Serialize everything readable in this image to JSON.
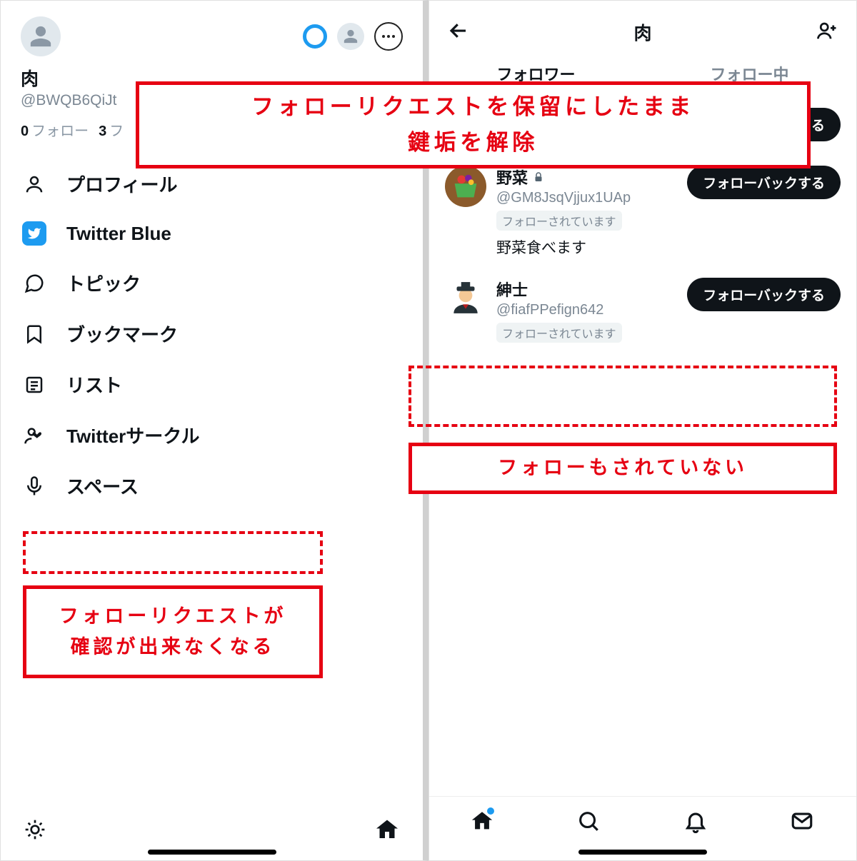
{
  "left": {
    "name": "肉",
    "handle": "@BWQB6QiJt",
    "following_count": "0",
    "following_label": "フォロー",
    "followers_count": "3",
    "followers_label": "フ",
    "menu": {
      "profile": "プロフィール",
      "blue": "Twitter Blue",
      "topics": "トピック",
      "bookmarks": "ブックマーク",
      "lists": "リスト",
      "circle": "Twitterサークル",
      "spaces": "スペース"
    }
  },
  "right": {
    "title": "肉",
    "tabs": {
      "followers": "フォロワー",
      "following": "フォロー中"
    },
    "follow_btn": "フォローする",
    "followback_btn": "フォローバックする",
    "followed_badge": "フォローされています",
    "users": [
      {
        "name": "野菜",
        "locked": true,
        "handle": "@GM8JsqVjjux1UAp",
        "bio": "野菜食べます",
        "btn": "followback"
      },
      {
        "name": "紳士",
        "locked": false,
        "handle": "@fiafPPefign642",
        "bio": "",
        "btn": "followback"
      }
    ]
  },
  "annotations": {
    "top": "フォローリクエストを保留にしたまま\n鍵垢を解除",
    "left_box": "フォローリクエストが\n確認が出来なくなる",
    "right_box": "フォローもされていない"
  }
}
